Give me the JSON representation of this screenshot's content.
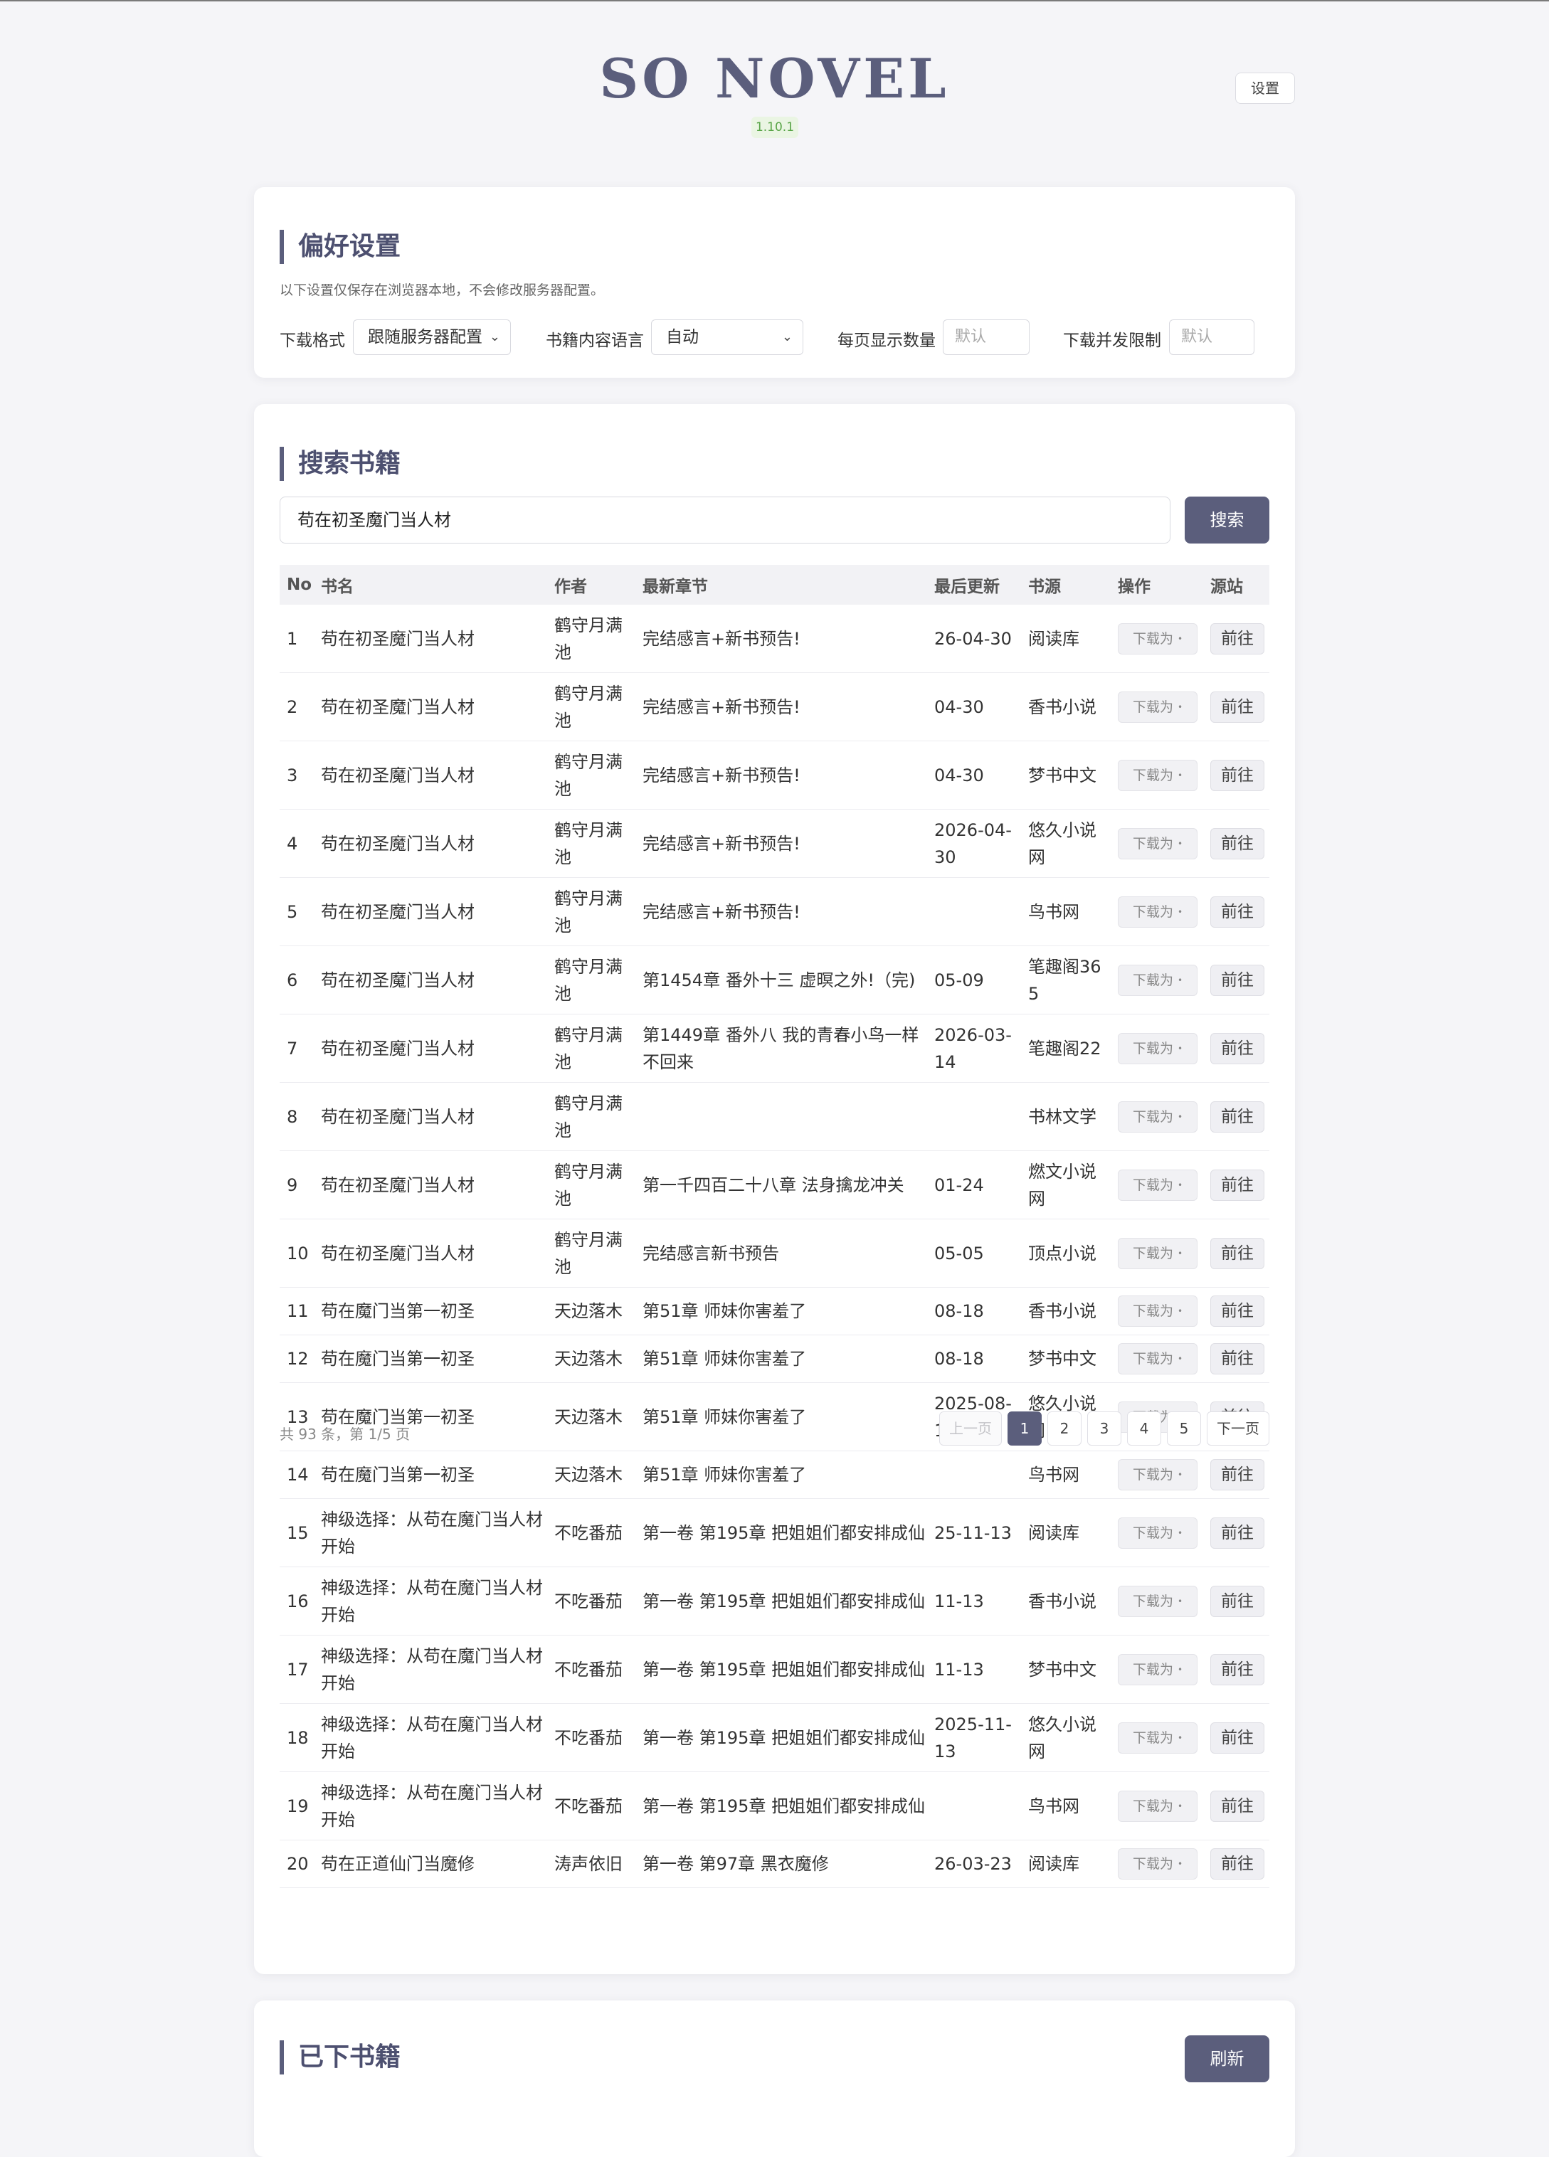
{
  "app": {
    "title": "SO NOVEL",
    "version": "1.10.1",
    "settings_label": "设置"
  },
  "prefs": {
    "title": "偏好设置",
    "note": "以下设置仅保存在浏览器本地，不会修改服务器配置。",
    "format_label": "下载格式",
    "format_value": "跟随服务器配置",
    "lang_label": "书籍内容语言",
    "lang_value": "自动",
    "per_page_label": "每页显示数量",
    "per_page_placeholder": "默认",
    "concurrency_label": "下载并发限制",
    "concurrency_placeholder": "默认"
  },
  "search": {
    "title": "搜索书籍",
    "query": "苟在初圣魔门当人材",
    "button": "搜索",
    "headers": [
      "No",
      "书名",
      "作者",
      "最新章节",
      "最后更新",
      "书源",
      "操作",
      "源站"
    ],
    "download_label": "下载为",
    "goto_label": "前往",
    "rows": [
      {
        "no": "1",
        "name": "苟在初圣魔门当人材",
        "author": "鹤守月满池",
        "chapter": "完结感言+新书预告!",
        "updated": "26-04-30",
        "source": "阅读库"
      },
      {
        "no": "2",
        "name": "苟在初圣魔门当人材",
        "author": "鹤守月满池",
        "chapter": "完结感言+新书预告!",
        "updated": "04-30",
        "source": "香书小说"
      },
      {
        "no": "3",
        "name": "苟在初圣魔门当人材",
        "author": "鹤守月满池",
        "chapter": "完结感言+新书预告!",
        "updated": "04-30",
        "source": "梦书中文"
      },
      {
        "no": "4",
        "name": "苟在初圣魔门当人材",
        "author": "鹤守月满池",
        "chapter": "完结感言+新书预告!",
        "updated": "2026-04-30",
        "source": "悠久小说网"
      },
      {
        "no": "5",
        "name": "苟在初圣魔门当人材",
        "author": "鹤守月满池",
        "chapter": "完结感言+新书预告!",
        "updated": "",
        "source": "鸟书网"
      },
      {
        "no": "6",
        "name": "苟在初圣魔门当人材",
        "author": "鹤守月满池",
        "chapter": "第1454章 番外十三 虚暝之外!（完)",
        "updated": "05-09",
        "source": "笔趣阁365"
      },
      {
        "no": "7",
        "name": "苟在初圣魔门当人材",
        "author": "鹤守月满池",
        "chapter": "第1449章 番外八 我的青春小鸟一样不回来",
        "updated": "2026-03-14",
        "source": "笔趣阁22"
      },
      {
        "no": "8",
        "name": "苟在初圣魔门当人材",
        "author": "鹤守月满池",
        "chapter": "",
        "updated": "",
        "source": "书林文学"
      },
      {
        "no": "9",
        "name": "苟在初圣魔门当人材",
        "author": "鹤守月满池",
        "chapter": "第一千四百二十八章 法身擒龙冲关",
        "updated": "01-24",
        "source": "燃文小说网"
      },
      {
        "no": "10",
        "name": "苟在初圣魔门当人材",
        "author": "鹤守月满池",
        "chapter": "完结感言新书预告",
        "updated": "05-05",
        "source": "顶点小说"
      },
      {
        "no": "11",
        "name": "苟在魔门当第一初圣",
        "author": "天边落木",
        "chapter": "第51章 师妹你害羞了",
        "updated": "08-18",
        "source": "香书小说"
      },
      {
        "no": "12",
        "name": "苟在魔门当第一初圣",
        "author": "天边落木",
        "chapter": "第51章 师妹你害羞了",
        "updated": "08-18",
        "source": "梦书中文"
      },
      {
        "no": "13",
        "name": "苟在魔门当第一初圣",
        "author": "天边落木",
        "chapter": "第51章 师妹你害羞了",
        "updated": "2025-08-18",
        "source": "悠久小说网"
      },
      {
        "no": "14",
        "name": "苟在魔门当第一初圣",
        "author": "天边落木",
        "chapter": "第51章 师妹你害羞了",
        "updated": "",
        "source": "鸟书网"
      },
      {
        "no": "15",
        "name": "神级选择：从苟在魔门当人材开始",
        "author": "不吃番茄",
        "chapter": "第一卷 第195章 把姐姐们都安排成仙",
        "updated": "25-11-13",
        "source": "阅读库"
      },
      {
        "no": "16",
        "name": "神级选择：从苟在魔门当人材开始",
        "author": "不吃番茄",
        "chapter": "第一卷 第195章 把姐姐们都安排成仙",
        "updated": "11-13",
        "source": "香书小说"
      },
      {
        "no": "17",
        "name": "神级选择：从苟在魔门当人材开始",
        "author": "不吃番茄",
        "chapter": "第一卷 第195章 把姐姐们都安排成仙",
        "updated": "11-13",
        "source": "梦书中文"
      },
      {
        "no": "18",
        "name": "神级选择：从苟在魔门当人材开始",
        "author": "不吃番茄",
        "chapter": "第一卷 第195章 把姐姐们都安排成仙",
        "updated": "2025-11-13",
        "source": "悠久小说网"
      },
      {
        "no": "19",
        "name": "神级选择：从苟在魔门当人材开始",
        "author": "不吃番茄",
        "chapter": "第一卷 第195章 把姐姐们都安排成仙",
        "updated": "",
        "source": "鸟书网"
      },
      {
        "no": "20",
        "name": "苟在正道仙门当魔修",
        "author": "涛声依旧",
        "chapter": "第一卷 第97章 黑衣魔修",
        "updated": "26-03-23",
        "source": "阅读库"
      }
    ],
    "pagination": {
      "summary": "共 93 条，第 1/5 页",
      "prev": "上一页",
      "next": "下一页",
      "pages": [
        "1",
        "2",
        "3",
        "4",
        "5"
      ],
      "current": "1"
    }
  },
  "downloaded": {
    "title": "已下书籍",
    "refresh_label": "刷新"
  }
}
